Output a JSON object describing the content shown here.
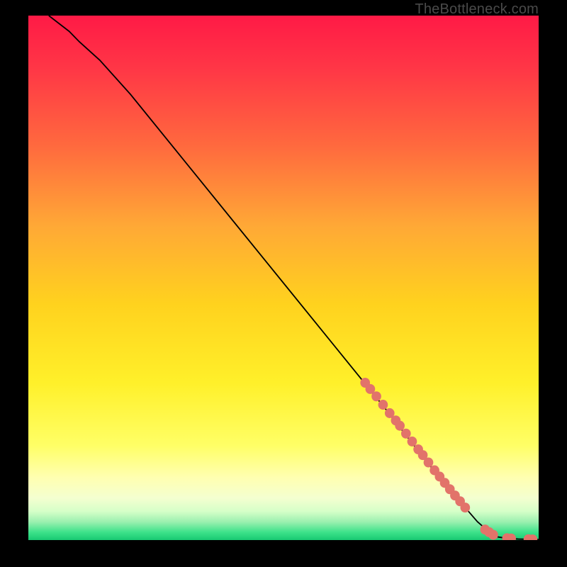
{
  "attribution": "TheBottleneck.com",
  "chart_data": {
    "type": "line",
    "title": "",
    "xlabel": "",
    "ylabel": "",
    "xlim": [
      0,
      100
    ],
    "ylim": [
      0,
      100
    ],
    "curve": {
      "name": "main-curve",
      "x": [
        4,
        6,
        8,
        10,
        14,
        20,
        30,
        40,
        50,
        60,
        70,
        78,
        84,
        88,
        90,
        91,
        92,
        94,
        96,
        98,
        100
      ],
      "y": [
        100,
        98.5,
        97,
        95,
        91.5,
        85,
        73,
        61,
        49,
        37,
        25,
        15,
        8,
        3.5,
        1.8,
        1.0,
        0.6,
        0.3,
        0.2,
        0.15,
        0.1
      ]
    },
    "scatter": {
      "name": "highlight-points",
      "color": "#e2736a",
      "x": [
        66,
        67,
        68.2,
        69.5,
        70.8,
        72,
        72.8,
        74,
        75.2,
        76.4,
        77.3,
        78.4,
        79.6,
        80.6,
        81.6,
        82.6,
        83.6,
        84.6,
        85.6,
        89.5,
        90.3,
        91.1,
        93.8,
        94.6,
        98.0,
        98.8
      ],
      "y": [
        30.0,
        28.8,
        27.4,
        25.8,
        24.2,
        22.8,
        21.8,
        20.3,
        18.8,
        17.3,
        16.2,
        14.8,
        13.3,
        12.1,
        10.9,
        9.7,
        8.5,
        7.4,
        6.2,
        2.0,
        1.5,
        1.0,
        0.35,
        0.3,
        0.15,
        0.12
      ]
    },
    "gradient_stops": [
      {
        "pos": 0.0,
        "color": "#ff1a46"
      },
      {
        "pos": 0.1,
        "color": "#ff3646"
      },
      {
        "pos": 0.25,
        "color": "#ff6a3e"
      },
      {
        "pos": 0.4,
        "color": "#ffa836"
      },
      {
        "pos": 0.55,
        "color": "#ffd21e"
      },
      {
        "pos": 0.7,
        "color": "#fff02a"
      },
      {
        "pos": 0.82,
        "color": "#ffff66"
      },
      {
        "pos": 0.88,
        "color": "#ffffb0"
      },
      {
        "pos": 0.92,
        "color": "#f4ffd0"
      },
      {
        "pos": 0.945,
        "color": "#d6ffc8"
      },
      {
        "pos": 0.965,
        "color": "#9cf0b0"
      },
      {
        "pos": 0.985,
        "color": "#3de28a"
      },
      {
        "pos": 1.0,
        "color": "#18c972"
      }
    ]
  }
}
